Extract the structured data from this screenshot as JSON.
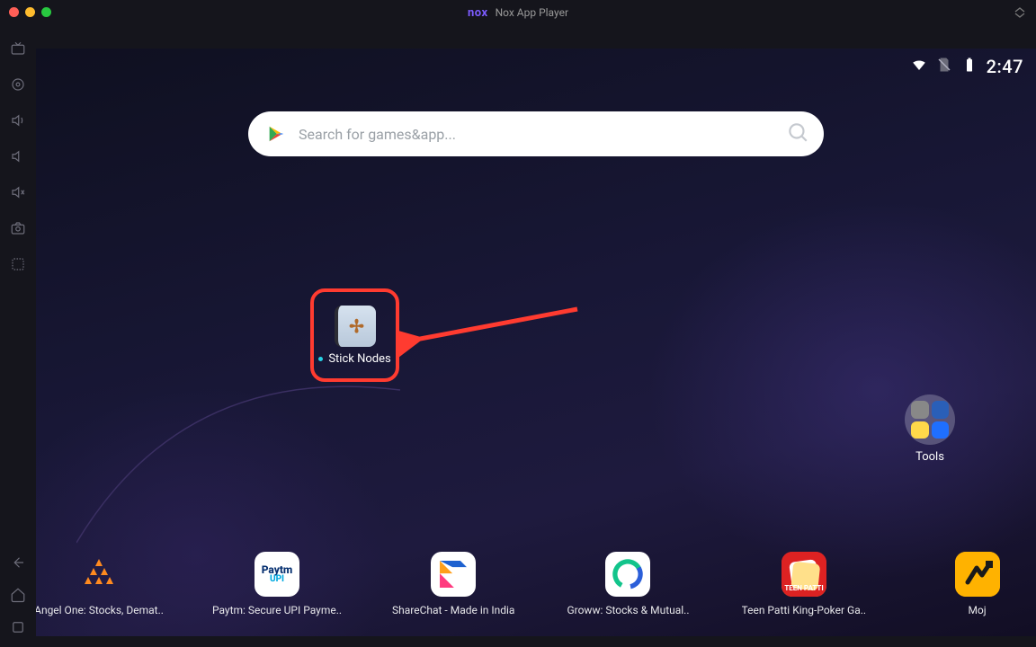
{
  "window": {
    "title": "Nox App Player",
    "logo_text": "nox"
  },
  "status": {
    "time": "2:47"
  },
  "search": {
    "placeholder": "Search for games&app..."
  },
  "highlighted_app": {
    "label": "Stick Nodes"
  },
  "tools_folder": {
    "label": "Tools"
  },
  "dock": [
    {
      "label": "Angel One: Stocks, Demat.."
    },
    {
      "label": "Paytm: Secure UPI Payme.."
    },
    {
      "label": "ShareChat - Made in India"
    },
    {
      "label": "Groww: Stocks & Mutual.."
    },
    {
      "label": "Teen Patti King-Poker Ga.."
    },
    {
      "label": "Moj"
    }
  ]
}
